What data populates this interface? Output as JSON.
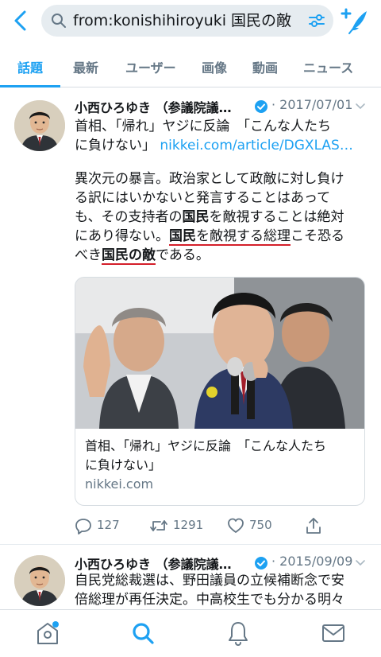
{
  "search": {
    "query": "from:konishihiroyuki 国民の敵"
  },
  "tabs": [
    {
      "label": "話題",
      "active": true
    },
    {
      "label": "最新",
      "active": false
    },
    {
      "label": "ユーザー",
      "active": false
    },
    {
      "label": "画像",
      "active": false
    },
    {
      "label": "動画",
      "active": false
    },
    {
      "label": "ニュース",
      "active": false
    }
  ],
  "colors": {
    "accent": "#1da1f2",
    "text": "#14171a",
    "muted": "#657786",
    "emphasis_underline": "#d41f2a"
  },
  "tweets": [
    {
      "author": "小西ひろゆき （参議院議…",
      "verified": true,
      "date": "· 2017/07/01",
      "headline_lines": [
        "首相、「帰れ」ヤジに反論　「こんな人たち",
        "に負けない」"
      ],
      "link": "nikkei.com/article/DGXLAS…",
      "body": {
        "line1": "異次元の暴言。政治家として政敵に対し負け",
        "line2": "る訳にはいかないと発言することはあって",
        "line3_a": "も、その支持者の",
        "line3_kw": "国民",
        "line3_b": "を敵視することは絶対",
        "line4_a": "にあり得ない。",
        "line4_kw": "国民",
        "line4_b": "を敵視する総理",
        "line4_c": "こそ恐る",
        "line5_a": "べき",
        "line5_kw": "国民の敵",
        "line5_b": "である。"
      },
      "card": {
        "title_lines": [
          "首相、「帰れ」ヤジに反論　「こんな人たち",
          "に負けない」"
        ],
        "domain": "nikkei.com"
      },
      "stats": {
        "replies": "127",
        "retweets": "1291",
        "likes": "750"
      }
    },
    {
      "author": "小西ひろゆき （参議院議…",
      "verified": true,
      "date": "· 2015/09/09",
      "body_lines": [
        "自民党総裁選は、野田議員の立候補断念で安",
        "倍総理が再任決定。中高校生でも分かる明々"
      ]
    }
  ],
  "icons": {
    "back": "chevron-left-icon",
    "search": "search-icon",
    "filter": "filter-icon",
    "compose": "compose-tweet-icon",
    "reply": "reply-icon",
    "retweet": "retweet-icon",
    "like": "heart-icon",
    "share": "share-icon",
    "home": "home-icon",
    "explore": "search-icon",
    "notifications": "bell-icon",
    "messages": "mail-icon"
  }
}
